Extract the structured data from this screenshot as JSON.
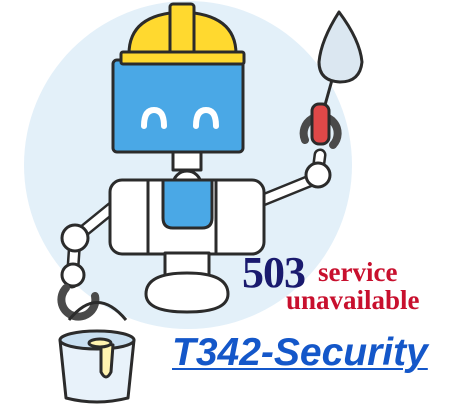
{
  "error": {
    "code": "503",
    "message_line1": "service",
    "message_line2": "unavailable"
  },
  "brand": {
    "link_text": "T342-Security"
  },
  "colors": {
    "code": "#1a1a6e",
    "message": "#c8102e",
    "link": "#1457c9",
    "helmet": "#ffd92f",
    "robot_head": "#4aa8e6",
    "background_circle": "#e3f0f9"
  },
  "illustration": {
    "subject": "robot-worker-icon",
    "accessories": [
      "hard-hat-icon",
      "trowel-icon",
      "paint-bucket-icon"
    ]
  }
}
